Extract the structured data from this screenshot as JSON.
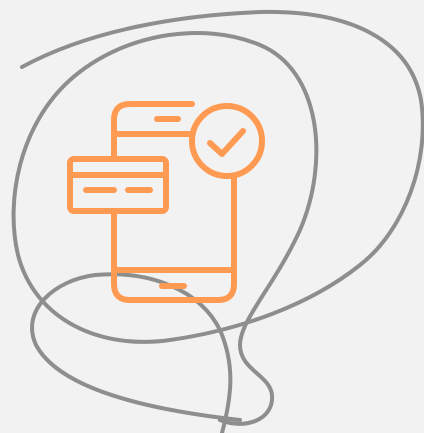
{
  "illustration": {
    "subject": "mobile-payment-confirmed",
    "icons": [
      "smartphone-icon",
      "credit-card-icon",
      "checkmark-badge-icon"
    ],
    "decoration": "scribble-loop",
    "colors": {
      "background": "#f2f2f2",
      "accent": "#ff9a52",
      "scribble": "#8e8e8e"
    }
  }
}
